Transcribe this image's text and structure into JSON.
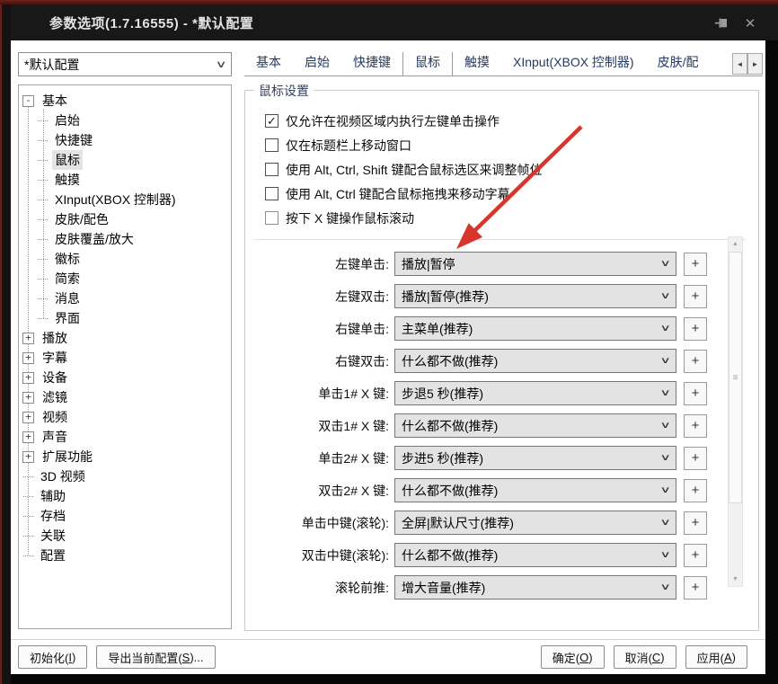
{
  "window": {
    "title": "参数选项(1.7.16555) - *默认配置"
  },
  "icons": {
    "chevron": "∨",
    "plus": "+",
    "close": "✕",
    "check": "✓",
    "tab_prev": "◄",
    "tab_next": "►",
    "scroll_up": "▲",
    "scroll_down": "▼",
    "grip": "≡"
  },
  "profile_combo": {
    "value": "*默认配置"
  },
  "tabs": {
    "items": [
      {
        "label": "基本"
      },
      {
        "label": "启始"
      },
      {
        "label": "快捷键"
      },
      {
        "label": "鼠标",
        "active": true
      },
      {
        "label": "触摸"
      },
      {
        "label": "XInput(XBOX 控制器)"
      },
      {
        "label": "皮肤/配"
      }
    ]
  },
  "tree": {
    "items": [
      {
        "label": "基本",
        "glyph": "-"
      },
      {
        "label": "启始"
      },
      {
        "label": "快捷键"
      },
      {
        "label": "鼠标",
        "selected": true
      },
      {
        "label": "触摸"
      },
      {
        "label": "XInput(XBOX 控制器)"
      },
      {
        "label": "皮肤/配色"
      },
      {
        "label": "皮肤覆盖/放大"
      },
      {
        "label": "徽标"
      },
      {
        "label": "简索"
      },
      {
        "label": "消息"
      },
      {
        "label": "界面"
      },
      {
        "label": "播放",
        "glyph": "+"
      },
      {
        "label": "字幕",
        "glyph": "+"
      },
      {
        "label": "设备",
        "glyph": "+"
      },
      {
        "label": "滤镜",
        "glyph": "+"
      },
      {
        "label": "视频",
        "glyph": "+"
      },
      {
        "label": "声音",
        "glyph": "+"
      },
      {
        "label": "扩展功能",
        "glyph": "+"
      },
      {
        "label": "3D 视频"
      },
      {
        "label": "辅助"
      },
      {
        "label": "存档"
      },
      {
        "label": "关联"
      },
      {
        "label": "配置"
      }
    ]
  },
  "mouse_settings": {
    "group_title": "鼠标设置",
    "checkboxes": [
      {
        "label": "仅允许在视频区域内执行左键单击操作",
        "checked": true
      },
      {
        "label": "仅在标题栏上移动窗口",
        "checked": false
      },
      {
        "label": "使用 Alt, Ctrl, Shift 键配合鼠标选区来调整帧位",
        "checked": false
      },
      {
        "label": "使用 Alt, Ctrl 键配合鼠标拖拽来移动字幕",
        "checked": false
      },
      {
        "label": "按下 X 键操作鼠标滚动",
        "checked": false,
        "focused": true
      }
    ],
    "rows": [
      {
        "label": "左键单击:",
        "value": "播放|暂停"
      },
      {
        "label": "左键双击:",
        "value": "播放|暂停(推荐)"
      },
      {
        "label": "右键单击:",
        "value": "主菜单(推荐)"
      },
      {
        "label": "右键双击:",
        "value": "什么都不做(推荐)"
      },
      {
        "label": "单击1# X 键:",
        "value": "步退5 秒(推荐)"
      },
      {
        "label": "双击1# X 键:",
        "value": "什么都不做(推荐)"
      },
      {
        "label": "单击2# X 键:",
        "value": "步进5 秒(推荐)"
      },
      {
        "label": "双击2# X 键:",
        "value": "什么都不做(推荐)"
      },
      {
        "label": "单击中键(滚轮):",
        "value": "全屏|默认尺寸(推荐)"
      },
      {
        "label": "双击中键(滚轮):",
        "value": "什么都不做(推荐)"
      },
      {
        "label": "滚轮前推:",
        "value": "增大音量(推荐)"
      }
    ]
  },
  "footer": {
    "init": {
      "pre": "初始化(",
      "mn": "I",
      "post": ")"
    },
    "export": {
      "pre": "导出当前配置(",
      "mn": "S",
      "post": ")..."
    },
    "ok": {
      "pre": "确定(",
      "mn": "O",
      "post": ")"
    },
    "cancel": {
      "pre": "取消(",
      "mn": "C",
      "post": ")"
    },
    "apply": {
      "pre": "应用(",
      "mn": "A",
      "post": ")"
    }
  },
  "colors": {
    "arrow_red": "#d8362c",
    "focus_blue": "#3fa9e0",
    "titlebar": "#181818",
    "tab_text": "#233a63"
  }
}
